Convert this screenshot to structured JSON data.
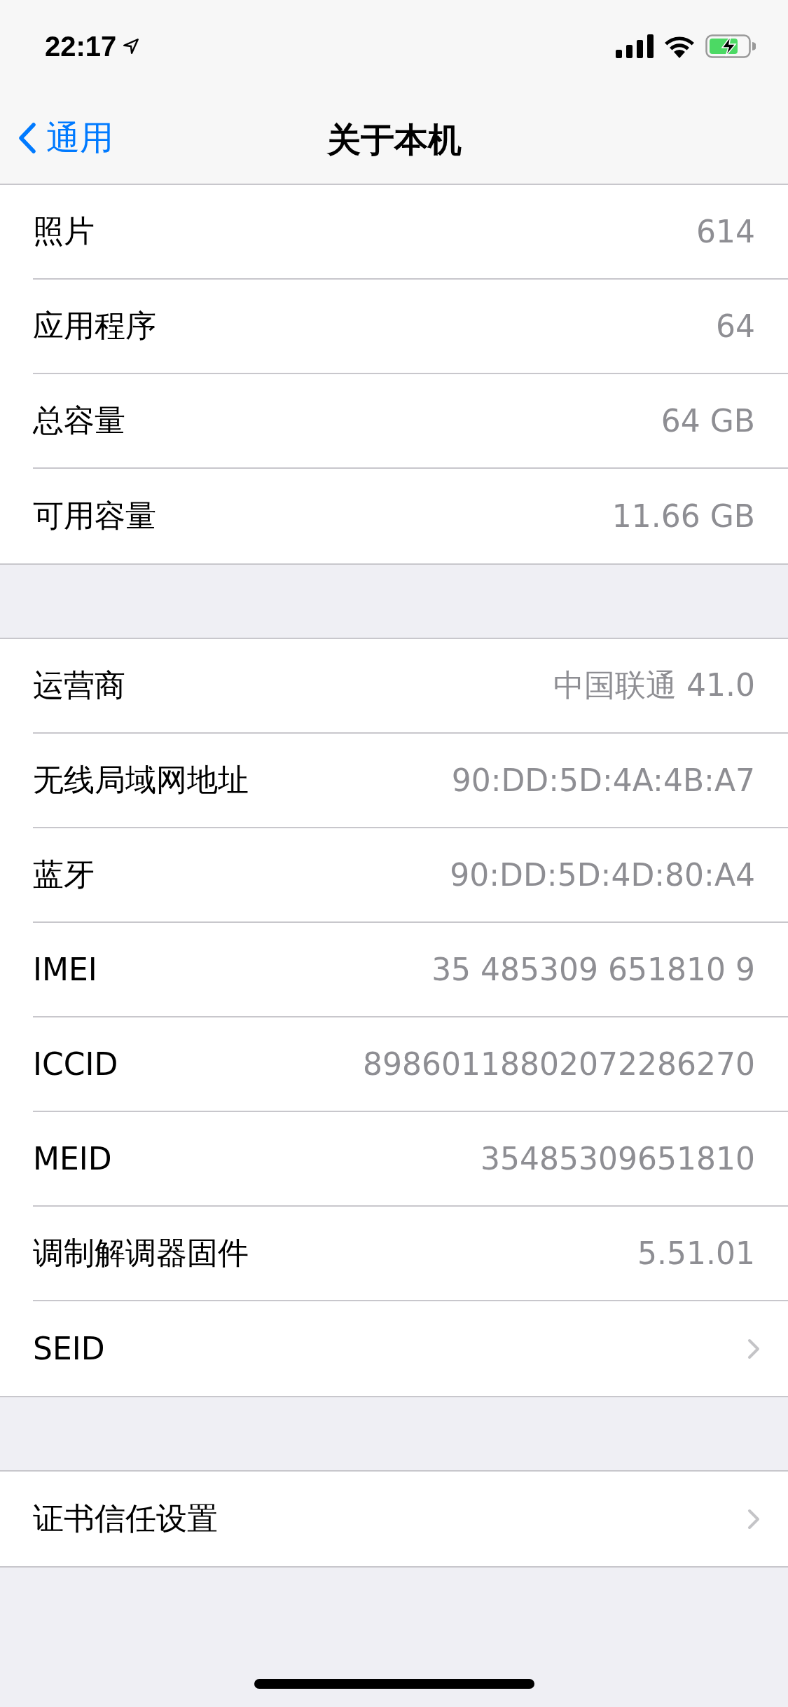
{
  "status_bar": {
    "time": "22:17"
  },
  "nav": {
    "back": "通用",
    "title": "关于本机"
  },
  "sections": [
    {
      "rows": [
        {
          "kind": "value",
          "label": "照片",
          "value": "614"
        },
        {
          "kind": "value",
          "label": "应用程序",
          "value": "64"
        },
        {
          "kind": "value",
          "label": "总容量",
          "value": "64 GB"
        },
        {
          "kind": "value",
          "label": "可用容量",
          "value": "11.66 GB"
        }
      ]
    },
    {
      "rows": [
        {
          "kind": "value",
          "label": "运营商",
          "value": "中国联通 41.0"
        },
        {
          "kind": "value",
          "label": "无线局域网地址",
          "value": "90:DD:5D:4A:4B:A7"
        },
        {
          "kind": "value",
          "label": "蓝牙",
          "value": "90:DD:5D:4D:80:A4"
        },
        {
          "kind": "value",
          "label": "IMEI",
          "value": "35 485309 651810 9"
        },
        {
          "kind": "value",
          "label": "ICCID",
          "value": "89860118802072286270"
        },
        {
          "kind": "value",
          "label": "MEID",
          "value": "35485309651810"
        },
        {
          "kind": "value",
          "label": "调制解调器固件",
          "value": "5.51.01"
        },
        {
          "kind": "link",
          "label": "SEID"
        }
      ]
    },
    {
      "rows": [
        {
          "kind": "link",
          "label": "证书信任设置"
        }
      ]
    }
  ]
}
